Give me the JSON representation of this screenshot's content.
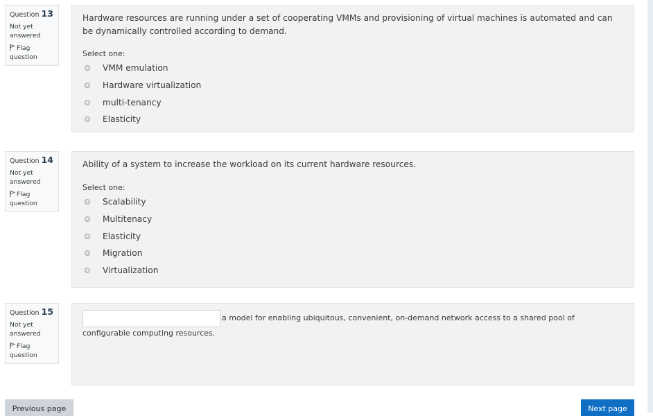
{
  "questions": [
    {
      "label": "Question",
      "number": "13",
      "state": "Not yet answered",
      "flag": "Flag question",
      "text": "Hardware resources are running under a set of cooperating VMMs and provisioning of virtual machines is automated and can be dynamically controlled according to demand.",
      "prompt": "Select one:",
      "options": [
        "VMM emulation",
        "Hardware virtualization",
        "multi-tenancy",
        "Elasticity"
      ]
    },
    {
      "label": "Question",
      "number": "14",
      "state": "Not yet answered",
      "flag": "Flag question",
      "text": "Ability of a system to increase the workload on its current hardware resources.",
      "prompt": "Select one:",
      "options": [
        "Scalability",
        "Multitenacy",
        "Elasticity",
        "Migration",
        "Virtualization"
      ]
    },
    {
      "label": "Question",
      "number": "15",
      "state": "Not yet answered",
      "flag": "Flag question",
      "after_blank": "a model for enabling ubiquitous, convenient, on-demand network access to a shared pool of",
      "line2": "configurable computing resources.",
      "blank_value": ""
    }
  ],
  "nav": {
    "previous_label": "Previous page",
    "next_label": "Next page"
  }
}
